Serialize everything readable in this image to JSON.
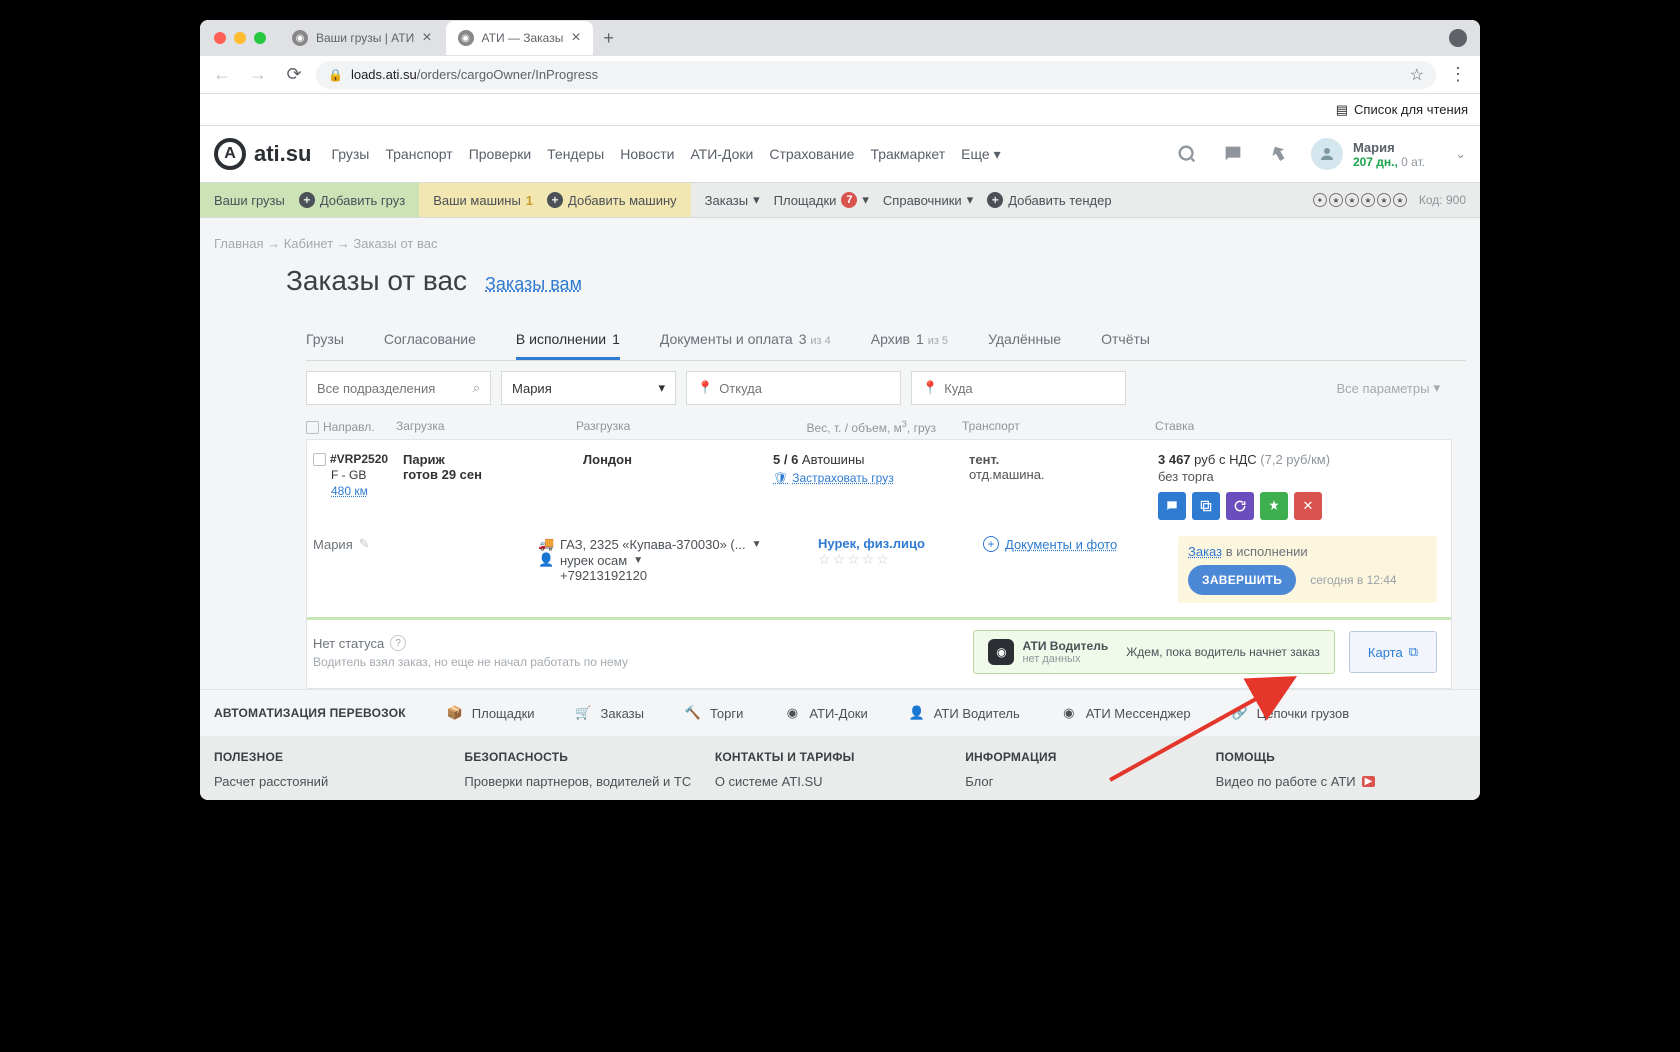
{
  "browser": {
    "tabs": [
      {
        "title": "Ваши грузы | АТИ",
        "active": false
      },
      {
        "title": "АТИ — Заказы",
        "active": true
      }
    ],
    "url_domain": "loads.ati.su",
    "url_path": "/orders/cargoOwner/InProgress",
    "reading_list": "Список для чтения"
  },
  "header": {
    "logo": "ati.su",
    "nav": [
      "Грузы",
      "Транспорт",
      "Проверки",
      "Тендеры",
      "Новости",
      "АТИ-Доки",
      "Страхование",
      "Тракмаркет"
    ],
    "more": "Еще",
    "user": {
      "name": "Мария",
      "days": "207 дн.,",
      "at": "0 ат."
    }
  },
  "secnav": {
    "green": {
      "label": "Ваши грузы",
      "add": "Добавить груз"
    },
    "yellow": {
      "label": "Ваши машины",
      "count": "1",
      "add": "Добавить машину"
    },
    "orders": "Заказы",
    "platforms": "Площадки",
    "platforms_count": "7",
    "refs": "Справочники",
    "add_tender": "Добавить тендер",
    "code": "Код: 900"
  },
  "breadcrumbs": {
    "a": "Главная",
    "b": "Кабинет",
    "c": "Заказы от вас"
  },
  "title": {
    "main": "Заказы от вас",
    "link": "Заказы вам"
  },
  "tabs": {
    "t1": "Грузы",
    "t2": "Согласование",
    "t3": "В исполнении",
    "t3c": "1",
    "t4": "Документы и оплата",
    "t4c": "3",
    "t4of": "из 4",
    "t5": "Архив",
    "t5c": "1",
    "t5of": "из 5",
    "t6": "Удалённые",
    "t7": "Отчёты"
  },
  "filters": {
    "dept_ph": "Все подразделения",
    "user": "Мария",
    "from_ph": "Откуда",
    "to_ph": "Куда",
    "all": "Все параметры"
  },
  "cols": {
    "c1": "Направл.",
    "c2": "Загрузка",
    "c3": "Разгрузка",
    "c4": "Вес, т. / объем, м³, груз",
    "c5": "Транспорт",
    "c6": "Ставка"
  },
  "order": {
    "id": "#VRP2520",
    "route": "F - GB",
    "dist": "480 км",
    "load_city": "Париж",
    "ready": "готов 29 сен",
    "unload_city": "Лондон",
    "weight": "5 / 6",
    "cargo": "Автошины",
    "insure": "Застраховать груз",
    "trans1": "тент.",
    "trans2": "отд.машина.",
    "price": "3 467",
    "price_unit": "руб с НДС",
    "per_km": "(7,2 руб/км)",
    "no_bargain": "без торга",
    "manager": "Мария",
    "vehicle": "ГАЗ, 2325 «Купава-370030» (...",
    "driver_name": "нурек осам",
    "phone": "+79213192120",
    "carrier": "Нурек, физ.лицо",
    "docs": "Документы и фото",
    "zakaz": "Заказ",
    "status_text": "в исполнении",
    "complete": "ЗАВЕРШИТЬ",
    "time": "сегодня в 12:44",
    "no_status": "Нет статуса",
    "note": "Водитель взял заказ, но еще не начал работать по нему",
    "ati_drv": "АТИ Водитель",
    "no_data": "нет данных",
    "wait": "Ждем, пока водитель начнет заказ",
    "map": "Карта"
  },
  "auto": {
    "label": "АВТОМАТИЗАЦИЯ ПЕРЕВОЗОК",
    "items": [
      "Площадки",
      "Заказы",
      "Торги",
      "АТИ-Доки",
      "АТИ Водитель",
      "АТИ Мессенджер",
      "Цепочки грузов"
    ]
  },
  "footer": {
    "c1h": "ПОЛЕЗНОЕ",
    "c1l": "Расчет расстояний",
    "c2h": "БЕЗОПАСНОСТЬ",
    "c2l": "Проверки партнеров, водителей и ТС",
    "c3h": "КОНТАКТЫ И ТАРИФЫ",
    "c3l": "О системе ATI.SU",
    "c4h": "ИНФОРМАЦИЯ",
    "c4l": "Блог",
    "c5h": "ПОМОЩЬ",
    "c5l": "Видео по работе с АТИ"
  }
}
